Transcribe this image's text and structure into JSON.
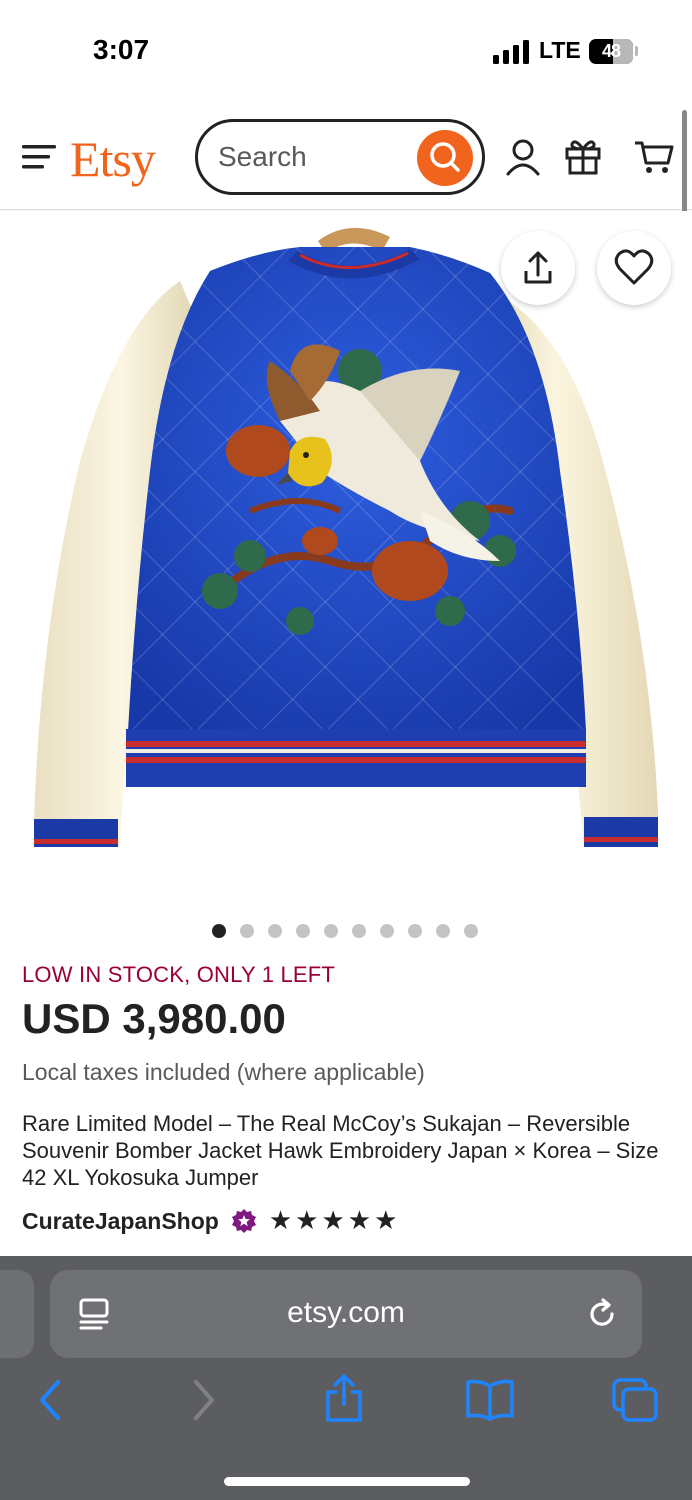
{
  "status_bar": {
    "time": "3:07",
    "network": "LTE",
    "battery": "48"
  },
  "header": {
    "logo": "Etsy",
    "search_placeholder": "Search",
    "icons": [
      "menu-icon",
      "search-icon",
      "account-icon",
      "gift-icon",
      "cart-icon"
    ]
  },
  "gallery": {
    "image_count": 10,
    "active_index": 0,
    "actions": [
      "share-icon",
      "favorite-heart-icon"
    ]
  },
  "listing": {
    "stock_notice": "LOW IN STOCK, ONLY 1 LEFT",
    "price": "USD 3,980.00",
    "taxes_note": "Local taxes included (where applicable)",
    "title": "Rare Limited Model – The Real McCoy’s Sukajan – Reversible Souvenir Bomber Jacket Hawk Embroidery Japan × Korea – Size 42 XL Yokosuka Jumper",
    "shop_name": "CurateJapanShop",
    "rating_stars": "★★★★★",
    "rating": 5
  },
  "browser": {
    "url": "etsy.com",
    "icons": [
      "reader-mode-icon",
      "reload-icon",
      "back-icon",
      "forward-icon",
      "share-icon",
      "bookmarks-icon",
      "tabs-icon"
    ]
  },
  "colors": {
    "brand": "#f1641e",
    "stock_notice": "#9b0033",
    "star_seller": "#7f187f",
    "safari_bar": "#5c5d61",
    "safari_accent": "#0a84ff"
  }
}
